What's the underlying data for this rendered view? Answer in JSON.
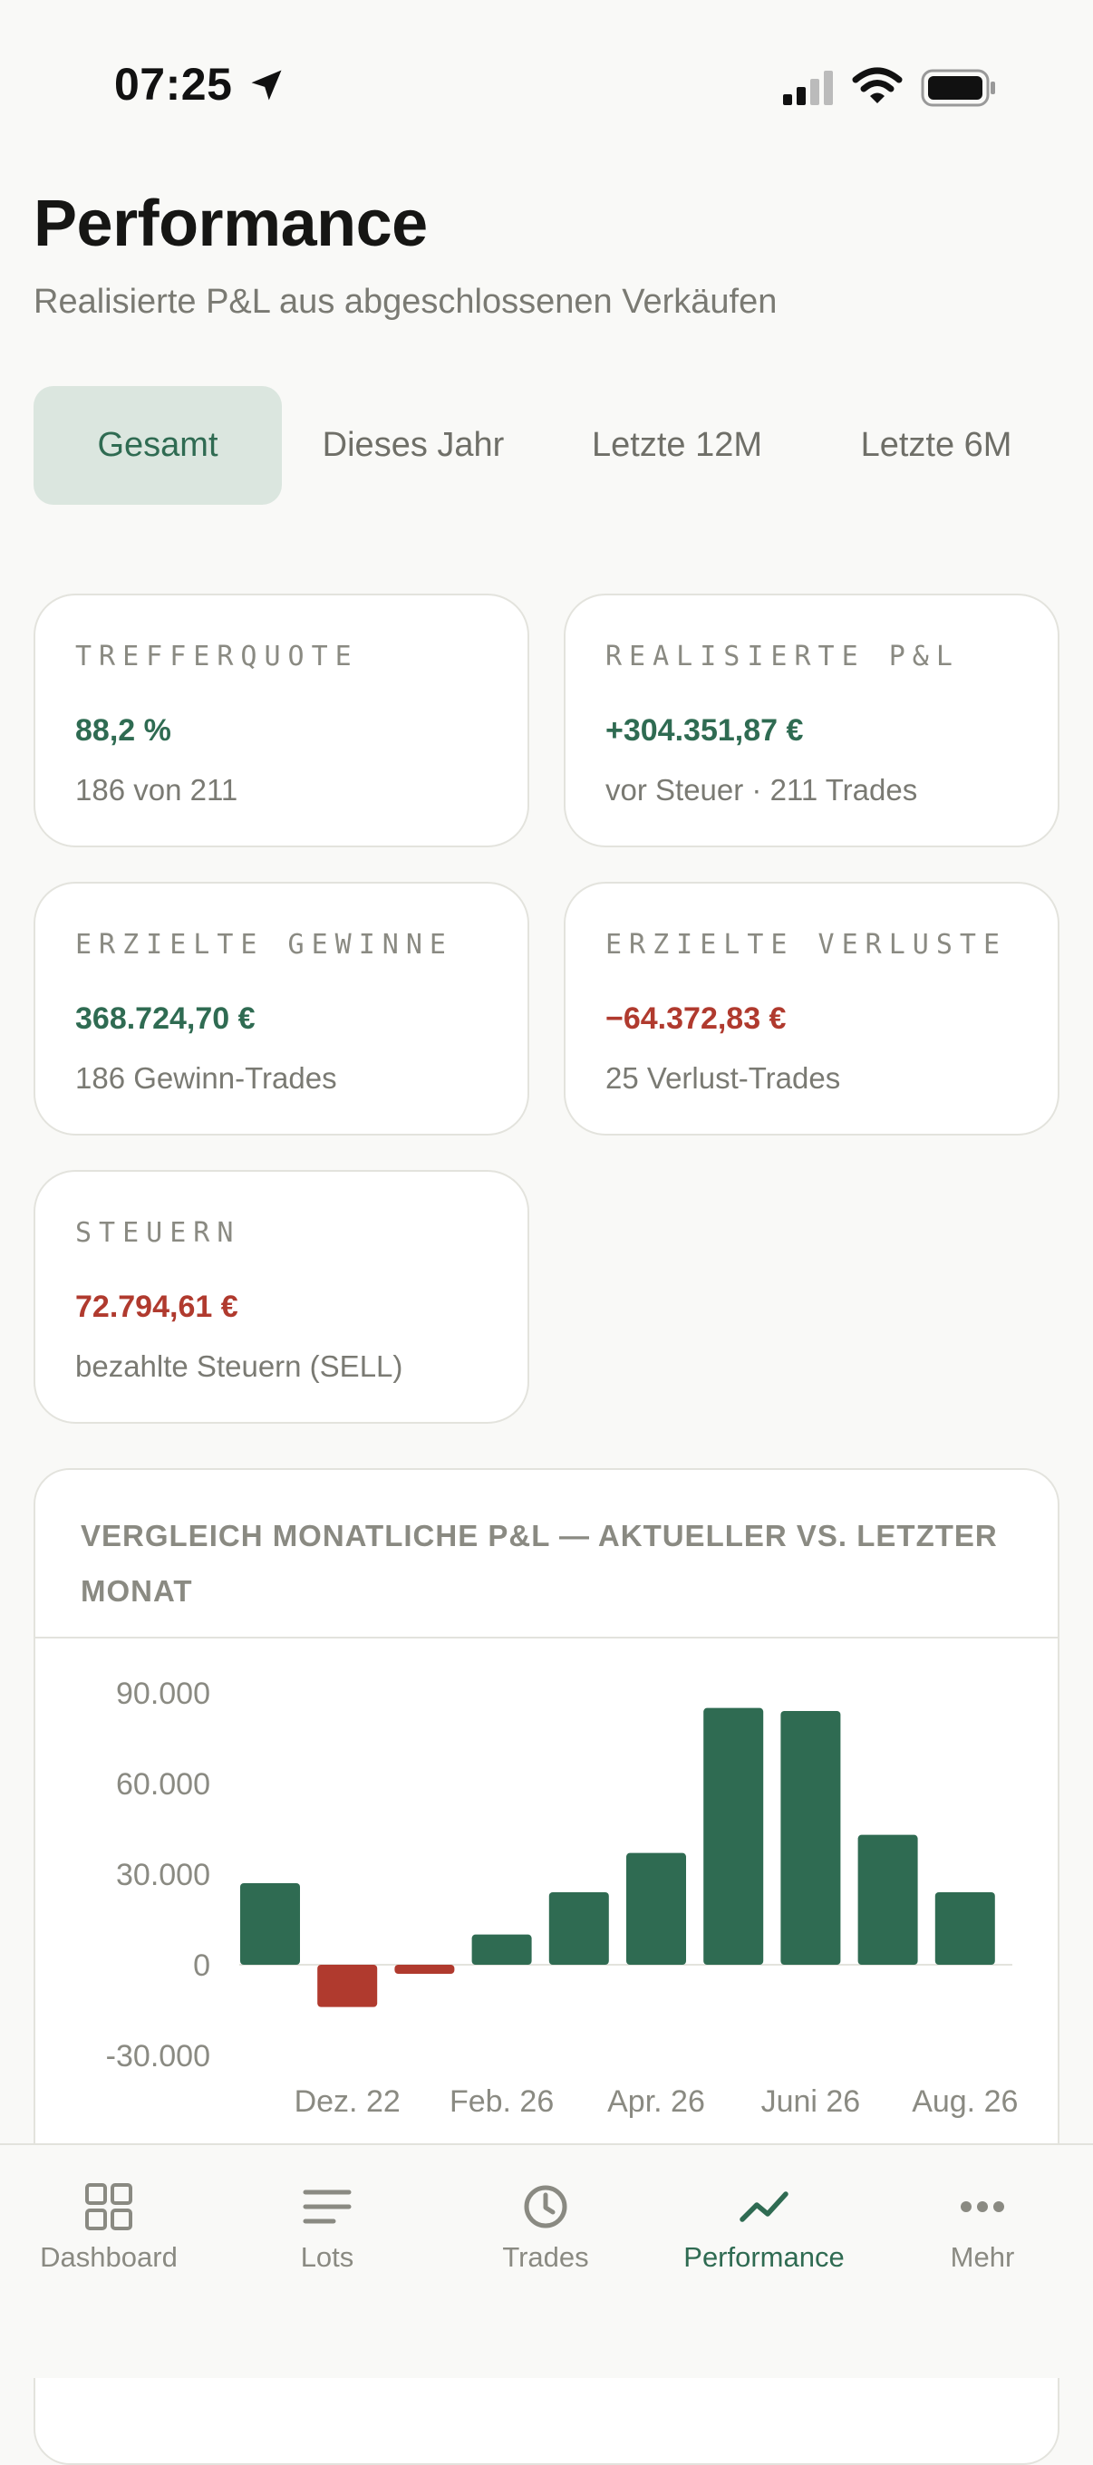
{
  "status": {
    "time": "07:25"
  },
  "header": {
    "title": "Performance",
    "subtitle": "Realisierte P&L aus abgeschlossenen Verkäufen"
  },
  "period_tabs": [
    {
      "label": "Gesamt",
      "active": true
    },
    {
      "label": "Dieses Jahr",
      "active": false
    },
    {
      "label": "Letzte 12M",
      "active": false
    },
    {
      "label": "Letzte 6M",
      "active": false
    }
  ],
  "cards": {
    "hit_rate": {
      "label": "TREFFERQUOTE",
      "value": "88,2 %",
      "sub": "186 von 211"
    },
    "realized_pl": {
      "label": "REALISIERTE P&L",
      "value": "+304.351,87 €",
      "sub": "vor Steuer · 211 Trades"
    },
    "gains": {
      "label": "ERZIELTE GEWINNE",
      "value": "368.724,70 €",
      "sub": "186 Gewinn-Trades"
    },
    "losses": {
      "label": "ERZIELTE VERLUSTE",
      "value": "−64.372,83 €",
      "sub": "25 Verlust-Trades"
    },
    "taxes": {
      "label": "STEUERN",
      "value": "72.794,61 €",
      "sub": "bezahlte Steuern (SELL)"
    }
  },
  "colors": {
    "positive": "#2f6b52",
    "negative": "#b03a2e",
    "accent_tab_bg": "#dbe6df"
  },
  "chart_data": {
    "type": "bar",
    "title": "VERGLEICH MONATLICHE P&L — AKTUELLER VS. LETZTER MONAT",
    "y_ticks": [
      "90.000",
      "60.000",
      "30.000",
      "0",
      "-30.000"
    ],
    "y_tick_values": [
      90000,
      60000,
      30000,
      0,
      -30000
    ],
    "ylim": [
      -30000,
      90000
    ],
    "x_tick_labels": [
      "Dez. 22",
      "Feb. 26",
      "Apr. 26",
      "Juni 26",
      "Aug. 26"
    ],
    "values": [
      27000,
      -14000,
      -3000,
      10000,
      24000,
      37000,
      85000,
      84000,
      43000,
      24000
    ],
    "positive_color": "#2f6b52",
    "negative_color": "#b03a2e"
  },
  "bottom_nav": [
    {
      "label": "Dashboard",
      "icon": "grid-icon",
      "active": false
    },
    {
      "label": "Lots",
      "icon": "list-icon",
      "active": false
    },
    {
      "label": "Trades",
      "icon": "clock-icon",
      "active": false
    },
    {
      "label": "Performance",
      "icon": "trend-icon",
      "active": true
    },
    {
      "label": "Mehr",
      "icon": "more-icon",
      "active": false
    }
  ]
}
